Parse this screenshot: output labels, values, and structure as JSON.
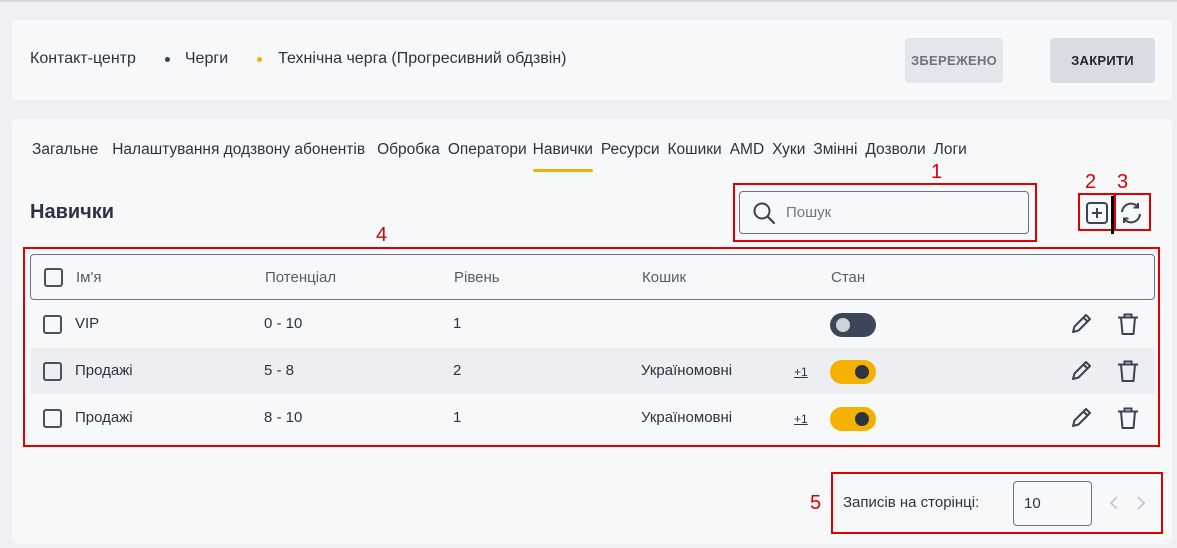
{
  "breadcrumb": {
    "items": [
      "Контакт-центр",
      "Черги",
      "Технічна черга (Прогресивний обдзвін)"
    ]
  },
  "header": {
    "saved_label": "ЗБЕРЕЖЕНО",
    "close_label": "ЗАКРИТИ"
  },
  "tabs": [
    {
      "label": "Загальне",
      "active": false
    },
    {
      "label": "Налаштування додзвону абонентів",
      "active": false
    },
    {
      "label": "Обробка",
      "active": false
    },
    {
      "label": "Оператори",
      "active": false
    },
    {
      "label": "Навички",
      "active": true
    },
    {
      "label": "Ресурси",
      "active": false
    },
    {
      "label": "Кошики",
      "active": false
    },
    {
      "label": "AMD",
      "active": false
    },
    {
      "label": "Хуки",
      "active": false
    },
    {
      "label": "Змінні",
      "active": false
    },
    {
      "label": "Дозволи",
      "active": false
    },
    {
      "label": "Логи",
      "active": false
    }
  ],
  "section": {
    "title": "Навички"
  },
  "search": {
    "placeholder": "Пошук"
  },
  "table": {
    "columns": [
      "Ім'я",
      "Потенціал",
      "Рівень",
      "Кошик",
      "Стан"
    ],
    "rows": [
      {
        "name": "VIP",
        "potential": "0 - 10",
        "level": "1",
        "basket": "",
        "basket_extra": "",
        "state_on": false
      },
      {
        "name": "Продажі",
        "potential": "5 - 8",
        "level": "2",
        "basket": "Україномовні",
        "basket_extra": "+1",
        "state_on": true
      },
      {
        "name": "Продажі",
        "potential": "8 - 10",
        "level": "1",
        "basket": "Україномовні",
        "basket_extra": "+1",
        "state_on": true
      }
    ]
  },
  "pagination": {
    "label": "Записів на сторінці:",
    "page_size": "10"
  },
  "annotations": [
    "1",
    "2",
    "3",
    "4",
    "5"
  ],
  "colors": {
    "accent": "#f5b100",
    "annotation": "#e00000",
    "toggle_off": "#3d4658"
  },
  "icons": [
    "search-icon",
    "add-icon",
    "refresh-icon",
    "pencil-icon",
    "trash-icon",
    "chevron-left-icon",
    "chevron-right-icon"
  ]
}
